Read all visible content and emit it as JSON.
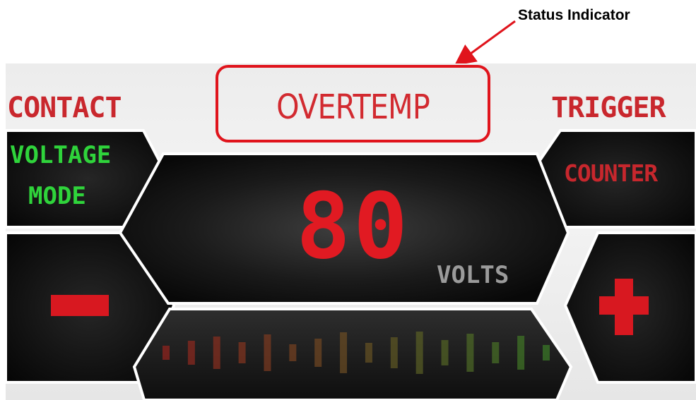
{
  "annotation": {
    "label": "Status Indicator"
  },
  "header": {
    "left_title": "CONTACT",
    "right_title": "TRIGGER"
  },
  "status": {
    "text": "OVERTEMP"
  },
  "mode_button": {
    "line1": "VOLTAGE",
    "line2": "MODE"
  },
  "counter_button": {
    "label": "COUNTER"
  },
  "readout": {
    "value": "80",
    "unit": "VOLTS"
  },
  "level_meter": {
    "bar_count": 16
  },
  "colors": {
    "accent_red": "#e11a22",
    "mode_green": "#2fd43b",
    "status_outline": "#e0141c",
    "panel_dark": "#0d0d0d",
    "unit_grey": "#9b9b9b"
  },
  "icons": {
    "decrease": "minus-icon",
    "increase": "plus-icon"
  }
}
